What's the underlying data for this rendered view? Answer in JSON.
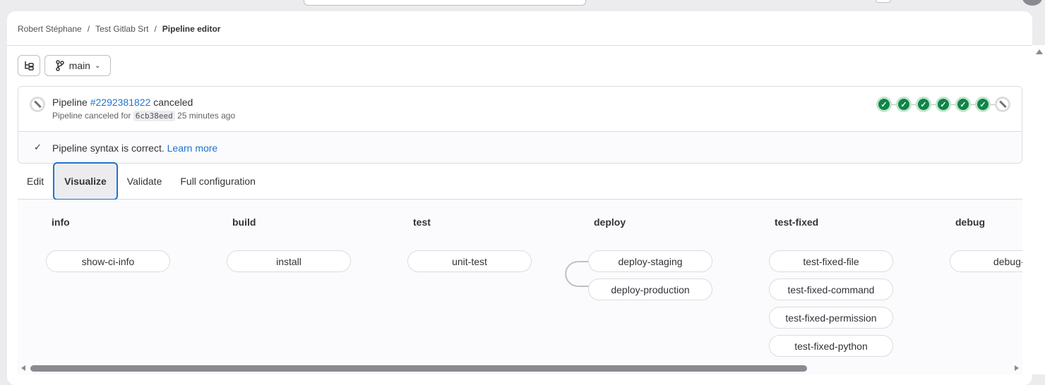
{
  "breadcrumb": [
    "Robert Stéphane",
    "Test Gitlab Srt",
    "Pipeline editor"
  ],
  "toolbar": {
    "branch": "main",
    "file_tree_icon": "file-tree-icon",
    "branch_icon": "branch-icon"
  },
  "pipeline": {
    "prefix": "Pipeline",
    "id": "#2292381822",
    "status": "canceled",
    "subtitle": "Pipeline canceled for",
    "commit": "6cb38eed",
    "time": "25 minutes ago",
    "mini_graph": [
      "success",
      "success",
      "success",
      "success",
      "success",
      "success",
      "canceled"
    ],
    "success_color": "#108548"
  },
  "validation": {
    "message": "Pipeline syntax is correct.",
    "link": "Learn more"
  },
  "tabs": [
    {
      "label": "Edit"
    },
    {
      "label": "Visualize",
      "active": true
    },
    {
      "label": "Validate"
    },
    {
      "label": "Full configuration"
    }
  ],
  "stages": [
    {
      "name": "info",
      "jobs": [
        "show-ci-info"
      ]
    },
    {
      "name": "build",
      "jobs": [
        "install"
      ]
    },
    {
      "name": "test",
      "jobs": [
        "unit-test"
      ]
    },
    {
      "name": "deploy",
      "jobs": [
        "deploy-staging",
        "deploy-production"
      ]
    },
    {
      "name": "test-fixed",
      "jobs": [
        "test-fixed-file",
        "test-fixed-command",
        "test-fixed-permission",
        "test-fixed-python"
      ]
    },
    {
      "name": "debug",
      "jobs": [
        "debug-tr"
      ]
    }
  ]
}
